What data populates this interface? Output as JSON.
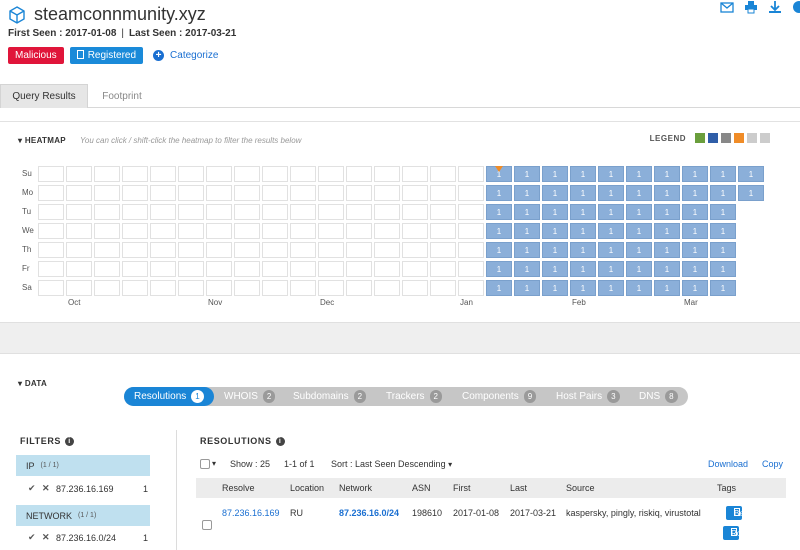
{
  "domain": {
    "name": "steamconnmunity.xyz",
    "first_seen_label": "First Seen : 2017-01-08",
    "last_seen_label": "Last Seen : 2017-03-21",
    "separator": "|"
  },
  "badges": {
    "malicious": "Malicious",
    "registered": "Registered",
    "categorize": "Categorize"
  },
  "tabs": [
    {
      "label": "Query Results",
      "active": true
    },
    {
      "label": "Footprint",
      "active": false
    }
  ],
  "heatmap": {
    "title": "HEATMAP",
    "hint": "You can click / shift-click the heatmap to filter the results below",
    "legend_label": "LEGEND",
    "legend_colors": [
      "#6a9e3c",
      "#2f5ea8",
      "#888888",
      "#f08c27",
      "#cccccc",
      "#cccccc"
    ],
    "days": [
      "Su",
      "Mo",
      "Tu",
      "We",
      "Th",
      "Fr",
      "Sa"
    ],
    "months": [
      "Oct",
      "Nov",
      "Dec",
      "Jan",
      "Feb",
      "Mar"
    ],
    "cell_value": "1",
    "active_color": "#8bafd9",
    "first_seen_color": "#f08c27"
  },
  "data_section": {
    "title": "DATA",
    "tabs": [
      {
        "label": "Resolutions",
        "count": "1",
        "active": true
      },
      {
        "label": "WHOIS",
        "count": "2",
        "active": false
      },
      {
        "label": "Subdomains",
        "count": "2",
        "active": false
      },
      {
        "label": "Trackers",
        "count": "2",
        "active": false
      },
      {
        "label": "Components",
        "count": "9",
        "active": false
      },
      {
        "label": "Host Pairs",
        "count": "3",
        "active": false
      },
      {
        "label": "DNS",
        "count": "8",
        "active": false
      }
    ]
  },
  "filters": {
    "title": "FILTERS",
    "groups": [
      {
        "name": "IP",
        "fraction": "(1 / 1)",
        "value": "87.236.16.169",
        "count": "1"
      },
      {
        "name": "NETWORK",
        "fraction": "(1 / 1)",
        "value": "87.236.16.0/24",
        "count": "1"
      }
    ]
  },
  "resolutions": {
    "title": "RESOLUTIONS",
    "show": "Show : 25",
    "range": "1-1 of 1",
    "sort": "Sort : Last Seen Descending",
    "download": "Download",
    "copy": "Copy",
    "columns": [
      "Resolve",
      "Location",
      "Network",
      "ASN",
      "First",
      "Last",
      "Source",
      "Tags"
    ],
    "rows": [
      {
        "resolve": "87.236.16.169",
        "location": "RU",
        "network": "87.236.16.0/24",
        "asn": "198610",
        "first": "2017-01-08",
        "last": "2017-03-21",
        "source": "kaspersky, pingly, riskiq, virustotal",
        "tags": [
          "Beget",
          "Routable"
        ]
      }
    ]
  }
}
